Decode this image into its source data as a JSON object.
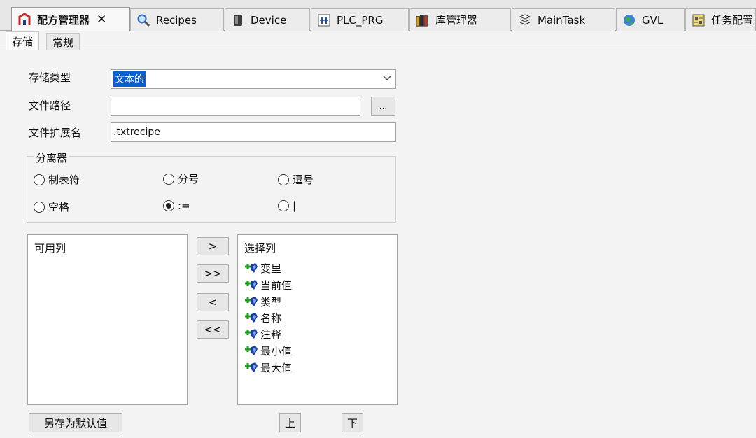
{
  "tabs": [
    {
      "label": "配方管理器",
      "icon": "recipe-manager-icon",
      "active": true,
      "closable": true
    },
    {
      "label": "Recipes",
      "icon": "magnifier-icon"
    },
    {
      "label": "Device",
      "icon": "device-icon"
    },
    {
      "label": "PLC_PRG",
      "icon": "program-icon"
    },
    {
      "label": "库管理器",
      "icon": "library-books-icon"
    },
    {
      "label": "MainTask",
      "icon": "task-icon"
    },
    {
      "label": "GVL",
      "icon": "globe-icon"
    },
    {
      "label": "任务配置",
      "icon": "task-config-icon"
    }
  ],
  "close_glyph": "✕",
  "subtabs": [
    {
      "label": "存储",
      "active": true
    },
    {
      "label": "常规"
    }
  ],
  "form": {
    "storage_type_label": "存储类型",
    "storage_type_value": "文本的",
    "file_path_label": "文件路径",
    "file_path_value": "",
    "browse_label": "...",
    "file_ext_label": "文件扩展名",
    "file_ext_value": ".txtrecipe"
  },
  "separator": {
    "title": "分离器",
    "options": [
      {
        "label": "制表符",
        "checked": false
      },
      {
        "label": "分号",
        "checked": false
      },
      {
        "label": "逗号",
        "checked": false
      },
      {
        "label": "空格",
        "checked": false
      },
      {
        "label": ":=",
        "checked": true
      },
      {
        "label": "|",
        "checked": false
      }
    ]
  },
  "available_columns": {
    "title": "可用列",
    "items": []
  },
  "transfer_buttons": {
    "add": ">",
    "add_all": ">>",
    "remove": "<",
    "remove_all": "<<"
  },
  "selected_columns": {
    "title": "选择列",
    "items": [
      "变里",
      "当前值",
      "类型",
      "名称",
      "注释",
      "最小值",
      "最大值"
    ]
  },
  "bottom_buttons": {
    "save_default": "另存为默认值",
    "up": "上",
    "down": "下"
  },
  "colors": {
    "selection_blue": "#0a5fd3",
    "icon_green": "#1e9e1e",
    "icon_blue": "#1a3fa8"
  }
}
